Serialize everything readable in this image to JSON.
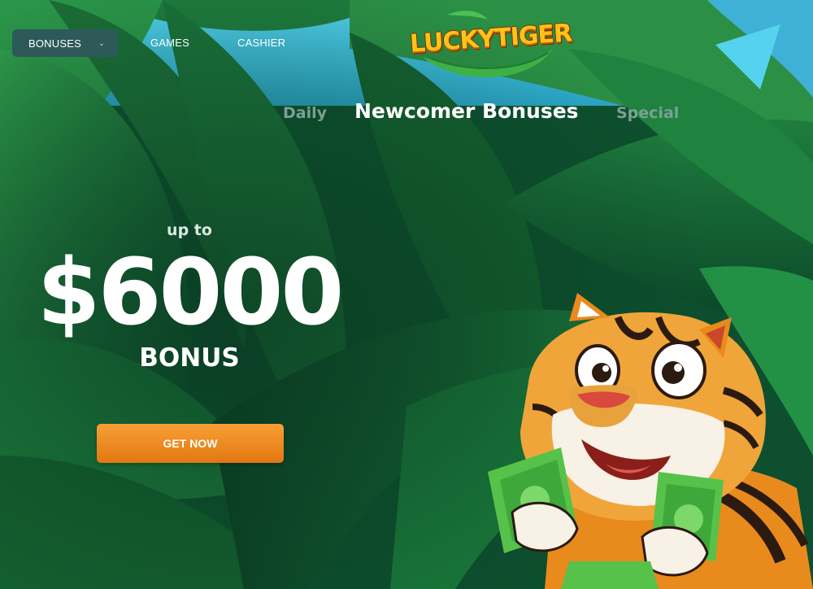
{
  "nav": {
    "bonuses_label": "BONUSES",
    "games_label": "GAMES",
    "cashier_label": "CASHIER"
  },
  "logo": {
    "text": "LUCKYTIGER"
  },
  "tabs": {
    "daily": "Daily",
    "newcomer": "Newcomer Bonuses",
    "special": "Special",
    "active": "Newcomer Bonuses"
  },
  "promo": {
    "up_to": "up to",
    "amount": "$6000",
    "bonus": "BONUS",
    "cta_label": "GET NOW"
  },
  "colors": {
    "nav_active_bg": "#2d5a59",
    "cta": "#f08a20",
    "tab_inactive": "#7aa193",
    "tab_active": "#ffffff",
    "jungle_dark": "#0c4a2c",
    "jungle_light": "#2f9a4a"
  },
  "icons": {
    "dropdown": "chevron-down-icon"
  }
}
